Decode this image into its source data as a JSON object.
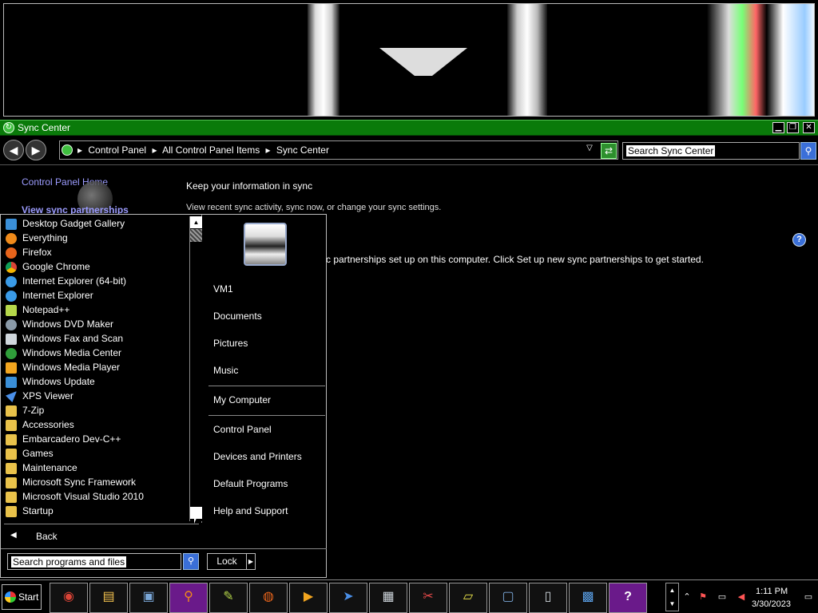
{
  "window": {
    "title": "Sync Center",
    "controls": {
      "minimize": "▁",
      "restore": "❐",
      "close": "✕"
    }
  },
  "toolbar": {
    "back_icon": "back-arrow-icon",
    "forward_icon": "forward-arrow-icon",
    "breadcrumbs": [
      "Control Panel",
      "All Control Panel Items",
      "Sync Center"
    ],
    "breadcrumb_separator": "▸",
    "search_placeholder": "Search Sync Center"
  },
  "content": {
    "sidebar_home": "Control Panel Home",
    "sidebar_view": "View sync partnerships",
    "heading": "Keep your information in sync",
    "subheading": "View recent sync activity, sync now, or change your sync settings.",
    "message": "c partnerships set up on this computer. Click Set up new sync partnerships to get started.",
    "help_label": "?"
  },
  "start_menu": {
    "programs": [
      {
        "label": "Desktop Gadget Gallery",
        "color": "#3a8fd8"
      },
      {
        "label": "Everything",
        "color": "#f08a1a"
      },
      {
        "label": "Firefox",
        "color": "#e8641b"
      },
      {
        "label": "Google Chrome",
        "color": "#34a853"
      },
      {
        "label": "Internet Explorer (64-bit)",
        "color": "#3a9be8"
      },
      {
        "label": "Internet Explorer",
        "color": "#3a9be8"
      },
      {
        "label": "Notepad++",
        "color": "#b6d84a"
      },
      {
        "label": "Windows DVD Maker",
        "color": "#8a9aa8"
      },
      {
        "label": "Windows Fax and Scan",
        "color": "#cfd6dc"
      },
      {
        "label": "Windows Media Center",
        "color": "#2f9e3a"
      },
      {
        "label": "Windows Media Player",
        "color": "#f2a51f"
      },
      {
        "label": "Windows Update",
        "color": "#3a8fd8"
      },
      {
        "label": "XPS Viewer",
        "color": "#4a8fe8"
      },
      {
        "label": "7-Zip",
        "color": "#e9c24a"
      },
      {
        "label": "Accessories",
        "color": "#e9c24a"
      },
      {
        "label": "Embarcadero Dev-C++",
        "color": "#e9c24a"
      },
      {
        "label": "Games",
        "color": "#e9c24a"
      },
      {
        "label": "Maintenance",
        "color": "#e9c24a"
      },
      {
        "label": "Microsoft Sync Framework",
        "color": "#e9c24a"
      },
      {
        "label": "Microsoft Visual Studio 2010",
        "color": "#e9c24a"
      },
      {
        "label": "Startup",
        "color": "#e9c24a"
      }
    ],
    "back_label": "Back",
    "search_placeholder": "Search programs and files",
    "right_column": {
      "user": "VM1",
      "documents": "Documents",
      "pictures": "Pictures",
      "music": "Music",
      "computer": "My Computer",
      "control_panel": "Control Panel",
      "devices": "Devices and Printers",
      "defaults": "Default Programs",
      "help": "Help and Support"
    },
    "lock_label": "Lock"
  },
  "taskbar": {
    "start_label": "Start",
    "apps": [
      {
        "name": "chrome",
        "glyph": "◉",
        "color": "#db4437"
      },
      {
        "name": "explorer",
        "glyph": "▤",
        "color": "#f2c14e"
      },
      {
        "name": "computer",
        "glyph": "▣",
        "color": "#7aa7d8"
      },
      {
        "name": "search-everything",
        "glyph": "⚲",
        "color": "#f08a1a"
      },
      {
        "name": "notepad-plus",
        "glyph": "✎",
        "color": "#b6d84a"
      },
      {
        "name": "firefox",
        "glyph": "◍",
        "color": "#e8641b"
      },
      {
        "name": "media-player",
        "glyph": "▶",
        "color": "#f2a51f"
      },
      {
        "name": "xps-viewer",
        "glyph": "➤",
        "color": "#4a8fe8"
      },
      {
        "name": "calculator",
        "glyph": "▦",
        "color": "#cfd6dc"
      },
      {
        "name": "snipping-tool",
        "glyph": "✂",
        "color": "#e84a4a"
      },
      {
        "name": "sticky-notes",
        "glyph": "▱",
        "color": "#e9e34a"
      },
      {
        "name": "remote-desktop",
        "glyph": "▢",
        "color": "#7aa7d8"
      },
      {
        "name": "notepad",
        "glyph": "▯",
        "color": "#cfd6dc"
      },
      {
        "name": "control-panel",
        "glyph": "▩",
        "color": "#5aa0e8"
      },
      {
        "name": "help",
        "glyph": "?",
        "color": "#3a6fd8"
      }
    ],
    "clock_time": "1:11 PM",
    "clock_date": "3/30/2023"
  }
}
